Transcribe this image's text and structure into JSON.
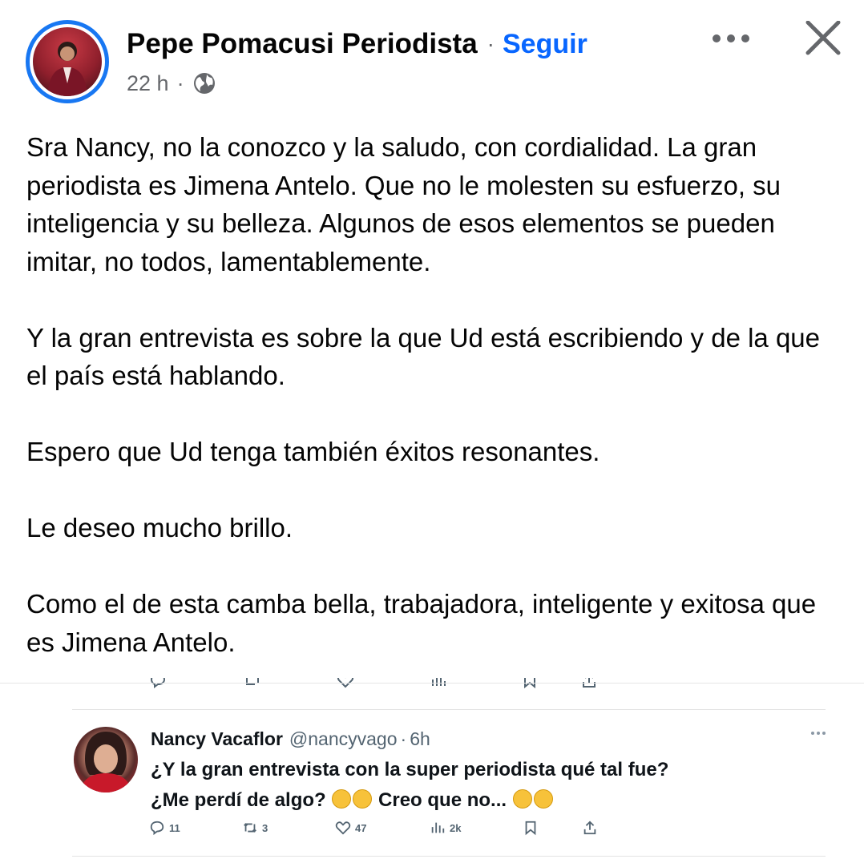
{
  "post": {
    "author": "Pepe Pomacusi Periodista",
    "separator": "·",
    "follow_label": "Seguir",
    "time": "22 h",
    "meta_separator": "·",
    "privacy_icon": "globe-icon",
    "paragraphs": [
      "Sra Nancy, no la conozco y la saludo, con cordialidad. La gran periodista es Jimena Antelo. Que no le molesten su esfuerzo, su inteligencia y su belleza. Algunos de esos elementos se pueden imitar, no todos, lamentablemente.",
      "Y la gran entrevista es sobre la que Ud está escribiendo y de la que el país está hablando.",
      "Espero que Ud tenga también éxitos resonantes.",
      "Le deseo mucho brillo.",
      "Como el de esta camba bella, trabajadora, inteligente y exitosa que es Jimena Antelo."
    ]
  },
  "tweet": {
    "name": "Nancy Vacaflor",
    "handle": "@nancyvago",
    "separator": "·",
    "time": "6h",
    "line1": "¿Y la gran entrevista con la super periodista qué tal fue?",
    "line2_a": "¿Me perdí de algo?",
    "line2_b": "Creo que no...",
    "actions": {
      "replies": "11",
      "retweets": "3",
      "likes": "47",
      "views": "2k"
    }
  },
  "colors": {
    "follow": "#0866ff",
    "avatar_ring": "#1877f2",
    "meta": "#65676b",
    "tweet_meta": "#536471"
  }
}
